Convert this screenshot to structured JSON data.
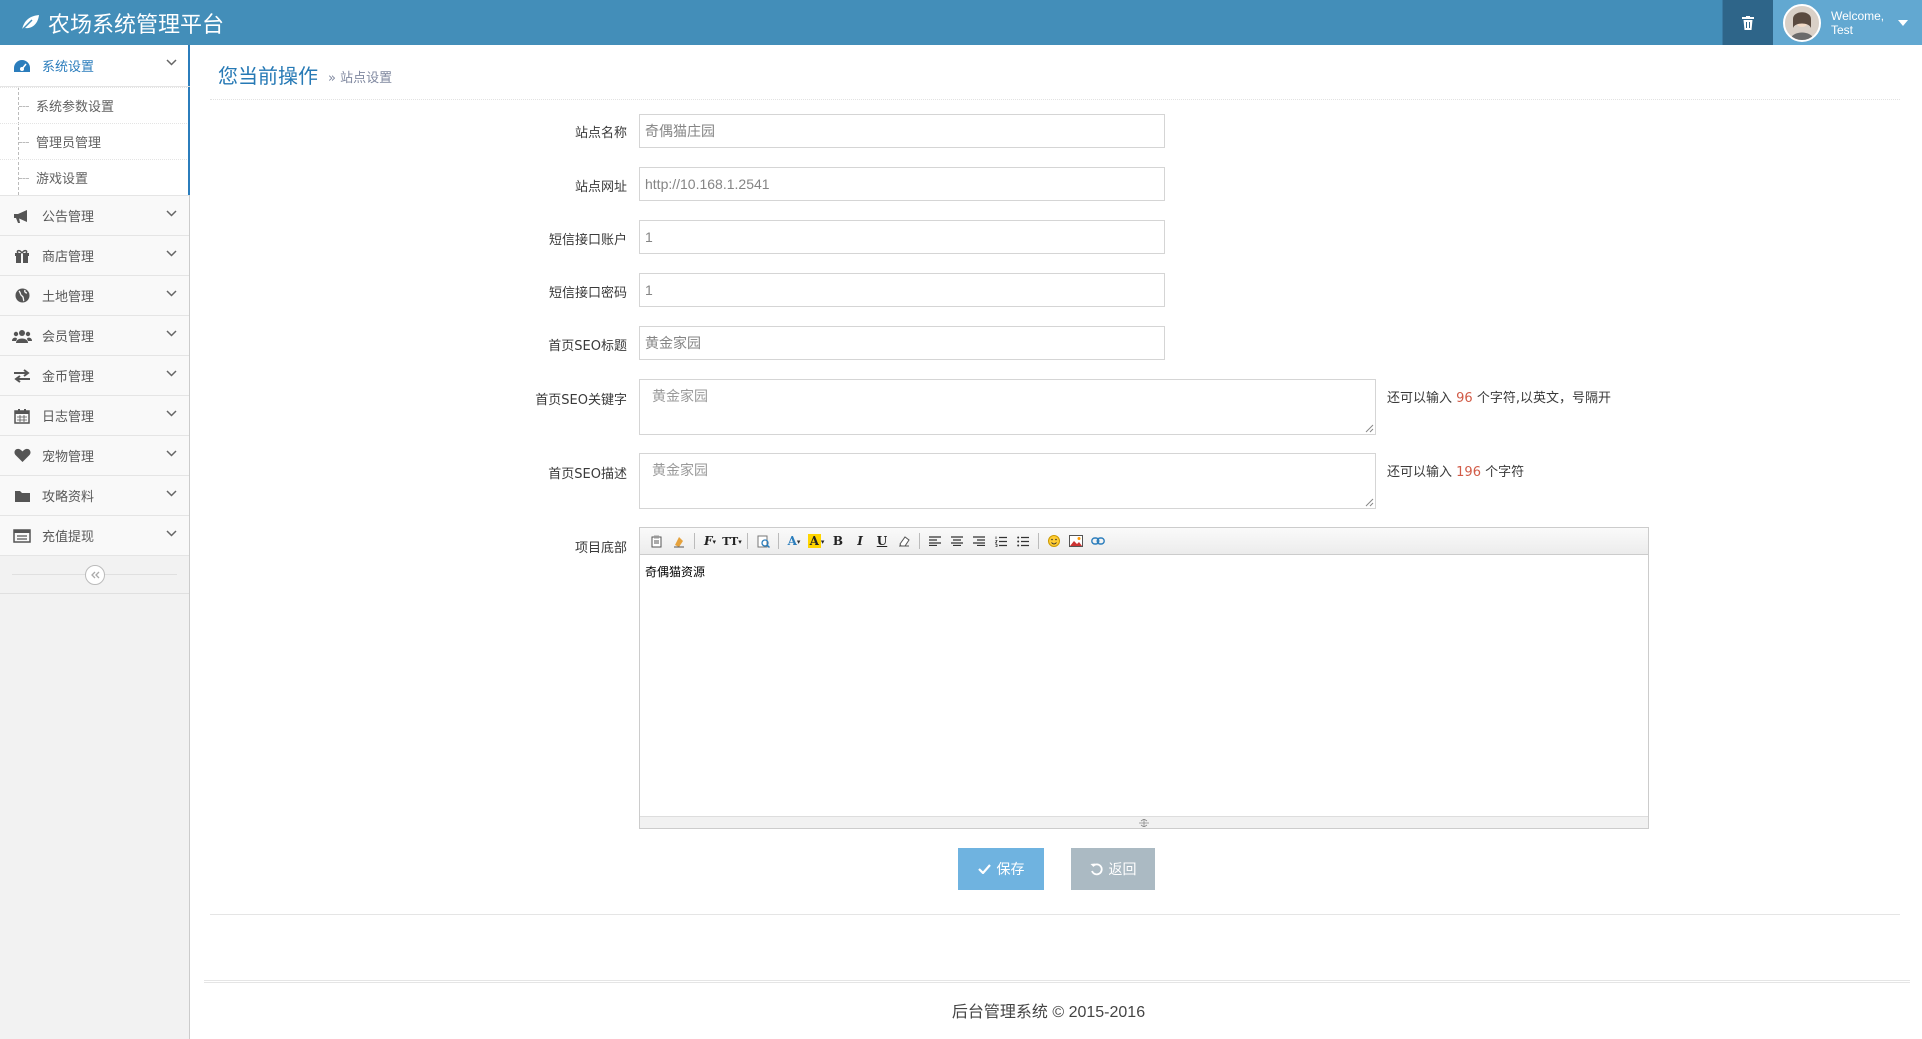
{
  "header": {
    "title": "农场系统管理平台",
    "welcome": "Welcome,",
    "username": "Test"
  },
  "sidebar": {
    "items": [
      {
        "label": "系统设置",
        "icon": "dashboard-icon",
        "active": true,
        "children": [
          "系统参数设置",
          "管理员管理",
          "游戏设置"
        ]
      },
      {
        "label": "公告管理",
        "icon": "bullhorn-icon"
      },
      {
        "label": "商店管理",
        "icon": "gift-icon"
      },
      {
        "label": "土地管理",
        "icon": "globe-icon"
      },
      {
        "label": "会员管理",
        "icon": "users-icon"
      },
      {
        "label": "金币管理",
        "icon": "exchange-icon"
      },
      {
        "label": "日志管理",
        "icon": "calendar-icon"
      },
      {
        "label": "宠物管理",
        "icon": "heart-icon"
      },
      {
        "label": "攻略资料",
        "icon": "folder-icon"
      },
      {
        "label": "充值提现",
        "icon": "list-alt-icon"
      }
    ]
  },
  "breadcrumb": {
    "title": "您当前操作",
    "current": "站点设置"
  },
  "form": {
    "site_name": {
      "label": "站点名称",
      "value": "奇偶猫庄园"
    },
    "site_url": {
      "label": "站点网址",
      "value": "http://10.168.1.2541"
    },
    "sms_account": {
      "label": "短信接口账户",
      "value": "1"
    },
    "sms_password": {
      "label": "短信接口密码",
      "value": "1"
    },
    "seo_title": {
      "label": "首页SEO标题",
      "value": "黄金家园"
    },
    "seo_keywords": {
      "label": "首页SEO关键字",
      "value": "黄金家园",
      "hint_prefix": "还可以输入",
      "hint_count": "96",
      "hint_suffix": "个字符,以英文，号隔开"
    },
    "seo_desc": {
      "label": "首页SEO描述",
      "value": "黄金家园",
      "hint_prefix": "还可以输入",
      "hint_count": "196",
      "hint_suffix": "个字符"
    },
    "footer_field": {
      "label": "项目底部",
      "value": "奇偶猫资源"
    }
  },
  "buttons": {
    "save": "保存",
    "back": "返回"
  },
  "footer": {
    "copyright": "后台管理系统 © 2015-2016"
  }
}
